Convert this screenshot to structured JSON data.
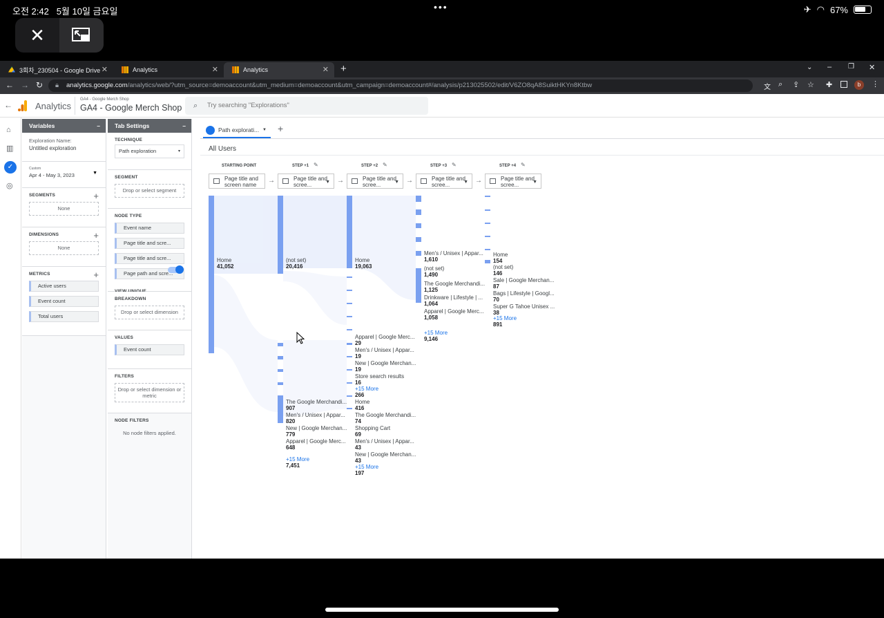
{
  "status": {
    "time": "오전 2:42",
    "date": "5월 10일 금요일",
    "dots": "•••",
    "battery": "67%"
  },
  "browser": {
    "tabs": [
      {
        "label": "3회차_230504 - Google Drive"
      },
      {
        "label": "Analytics"
      },
      {
        "label": "Analytics"
      }
    ],
    "url_host": "analytics.google.com",
    "url_path": "/analytics/web/?utm_source=demoaccount&utm_medium=demoaccount&utm_campaign=demoaccount#/analysis/p213025502/edit/V6ZO8qA8SuiktHKYn8Ktbw",
    "profile_initial": "b"
  },
  "ga": {
    "product": "Analytics",
    "account_small": "GA4 - Google Merch Shop",
    "property": "GA4 - Google Merch Shop",
    "search_placeholder": "Try searching \"Explorations\""
  },
  "variables": {
    "title": "Variables",
    "name_label": "Exploration Name:",
    "name_value": "Untitled exploration",
    "date_small": "Custom",
    "date_range": "Apr 4 - May 3, 2023",
    "segments_label": "SEGMENTS",
    "segments_none": "None",
    "dimensions_label": "DIMENSIONS",
    "dimensions_none": "None",
    "metrics_label": "METRICS",
    "metrics": [
      "Active users",
      "Event count",
      "Total users"
    ]
  },
  "tab_settings": {
    "title": "Tab Settings",
    "technique_label": "TECHNIQUE",
    "technique_value": "Path exploration",
    "segment_label": "SEGMENT",
    "segment_drop": "Drop or select segment",
    "node_type_label": "NODE TYPE",
    "node_types": [
      "Event name",
      "Page title and scre...",
      "Page title and scre...",
      "Page path and scre..."
    ],
    "unique_label": "VIEW UNIQUE NODES ONLY",
    "breakdown_label": "BREAKDOWN",
    "breakdown_drop": "Drop or select dimension",
    "values_label": "VALUES",
    "values_chip": "Event count",
    "filters_label": "FILTERS",
    "filters_drop": "Drop or select dimension or metric",
    "node_filters_label": "NODE FILTERS",
    "node_filters_empty": "No node filters applied."
  },
  "canvas": {
    "tab_label": "Path explorati...",
    "segment_title": "All Users",
    "steps": [
      {
        "head": "STARTING POINT",
        "sel": "Page title and screen name"
      },
      {
        "head": "STEP +1",
        "sel": "Page title and scree..."
      },
      {
        "head": "STEP +2",
        "sel": "Page title and scree..."
      },
      {
        "head": "STEP +3",
        "sel": "Page title and scree..."
      },
      {
        "head": "STEP +4",
        "sel": "Page title and scree..."
      }
    ],
    "col0": [
      {
        "name": "Home",
        "value": "41,052"
      }
    ],
    "col1": [
      {
        "name": "(not set)",
        "value": "20,416"
      },
      {
        "name": "The Google Merchandi...",
        "value": "907"
      },
      {
        "name": "Men's / Unisex | Appar...",
        "value": "820"
      },
      {
        "name": "New | Google Merchan...",
        "value": "779"
      },
      {
        "name": "Apparel | Google Merc...",
        "value": "648"
      },
      {
        "name": "+15 More",
        "value": "7,451"
      }
    ],
    "col2": [
      {
        "name": "Home",
        "value": "19,063"
      },
      {
        "name": "Apparel | Google Merc...",
        "value": "29"
      },
      {
        "name": "Men's / Unisex | Appar...",
        "value": "19"
      },
      {
        "name": "New | Google Merchan...",
        "value": "19"
      },
      {
        "name": "Store search results",
        "value": "16"
      },
      {
        "name": "+15 More",
        "value": "266"
      },
      {
        "name": "Home",
        "value": "416"
      },
      {
        "name": "The Google Merchandi...",
        "value": "74"
      },
      {
        "name": "Shopping Cart",
        "value": "69"
      },
      {
        "name": "Men's / Unisex | Appar...",
        "value": "43"
      },
      {
        "name": "New | Google Merchan...",
        "value": "43"
      },
      {
        "name": "+15 More",
        "value": "197"
      }
    ],
    "col3": [
      {
        "name": "Men's / Unisex | Appar...",
        "value": "1,610"
      },
      {
        "name": "(not set)",
        "value": "1,490"
      },
      {
        "name": "The Google Merchandi...",
        "value": "1,125"
      },
      {
        "name": "Drinkware | Lifestyle | ...",
        "value": "1,064"
      },
      {
        "name": "Apparel | Google Merc...",
        "value": "1,058"
      },
      {
        "name": "+15 More",
        "value": "9,146"
      }
    ],
    "col4": [
      {
        "name": "Home",
        "value": "154"
      },
      {
        "name": "(not set)",
        "value": "146"
      },
      {
        "name": "Sale | Google Merchan...",
        "value": "87"
      },
      {
        "name": "Bags | Lifestyle | Googl...",
        "value": "70"
      },
      {
        "name": "Super G Tahoe Unisex ...",
        "value": "38"
      },
      {
        "name": "+15 More",
        "value": "891"
      }
    ]
  }
}
